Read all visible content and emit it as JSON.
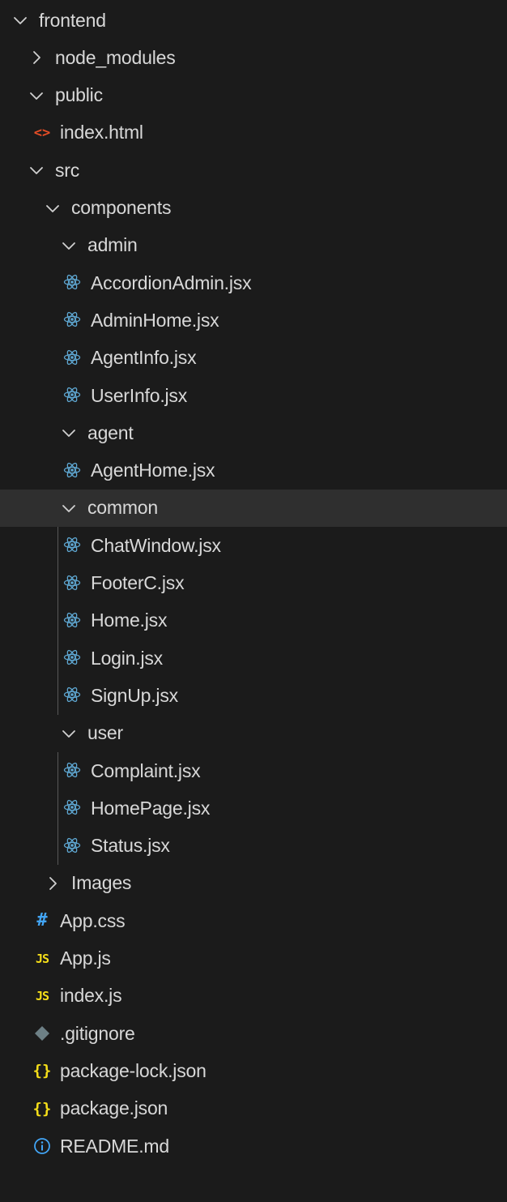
{
  "explorer": {
    "items": [
      {
        "label": "frontend",
        "kind": "folder-open",
        "depth": 0
      },
      {
        "label": "node_modules",
        "kind": "folder-closed",
        "depth": 1
      },
      {
        "label": "public",
        "kind": "folder-open",
        "depth": 1
      },
      {
        "label": "index.html",
        "kind": "html-file",
        "depth": 2
      },
      {
        "label": "src",
        "kind": "folder-open",
        "depth": 1
      },
      {
        "label": "components",
        "kind": "folder-open",
        "depth": 2
      },
      {
        "label": "admin",
        "kind": "folder-open",
        "depth": 3
      },
      {
        "label": "AccordionAdmin.jsx",
        "kind": "react-file",
        "depth": 4
      },
      {
        "label": "AdminHome.jsx",
        "kind": "react-file",
        "depth": 4
      },
      {
        "label": "AgentInfo.jsx",
        "kind": "react-file",
        "depth": 4
      },
      {
        "label": "UserInfo.jsx",
        "kind": "react-file",
        "depth": 4
      },
      {
        "label": "agent",
        "kind": "folder-open",
        "depth": 3
      },
      {
        "label": "AgentHome.jsx",
        "kind": "react-file",
        "depth": 4
      },
      {
        "label": "common",
        "kind": "folder-open",
        "depth": 3,
        "selected": true
      },
      {
        "label": "ChatWindow.jsx",
        "kind": "react-file",
        "depth": 4
      },
      {
        "label": "FooterC.jsx",
        "kind": "react-file",
        "depth": 4
      },
      {
        "label": "Home.jsx",
        "kind": "react-file",
        "depth": 4
      },
      {
        "label": "Login.jsx",
        "kind": "react-file",
        "depth": 4
      },
      {
        "label": "SignUp.jsx",
        "kind": "react-file",
        "depth": 4
      },
      {
        "label": "user",
        "kind": "folder-open",
        "depth": 3
      },
      {
        "label": "Complaint.jsx",
        "kind": "react-file",
        "depth": 4
      },
      {
        "label": "HomePage.jsx",
        "kind": "react-file",
        "depth": 4
      },
      {
        "label": "Status.jsx",
        "kind": "react-file",
        "depth": 4
      },
      {
        "label": "Images",
        "kind": "folder-closed",
        "depth": 2
      },
      {
        "label": "App.css",
        "kind": "css-file",
        "depth": 2
      },
      {
        "label": "App.js",
        "kind": "js-file",
        "depth": 2
      },
      {
        "label": "index.js",
        "kind": "js-file",
        "depth": 2
      },
      {
        "label": ".gitignore",
        "kind": "git-file",
        "depth": 1
      },
      {
        "label": "package-lock.json",
        "kind": "json-file",
        "depth": 1
      },
      {
        "label": "package.json",
        "kind": "json-file",
        "depth": 1
      },
      {
        "label": "README.md",
        "kind": "info-file",
        "depth": 1
      }
    ]
  },
  "icons": {
    "html-file": {
      "name": "html-icon",
      "glyph": "<>"
    },
    "css-file": {
      "name": "css-hash-icon",
      "glyph": "#"
    },
    "js-file": {
      "name": "js-icon",
      "glyph": "JS"
    },
    "json-file": {
      "name": "json-braces-icon",
      "glyph": "{}"
    },
    "git-file": {
      "name": "git-diamond-icon",
      "glyph": ""
    },
    "info-file": {
      "name": "info-icon",
      "glyph": ""
    },
    "react-file": {
      "name": "react-icon",
      "glyph": ""
    }
  },
  "colors": {
    "background": "#1b1b1b",
    "selected_row": "#2f2f2f",
    "text": "#d8d8d8",
    "guide_line": "#585858",
    "react_icon": "#5fa8d3",
    "html_icon": "#e44d26",
    "css_icon": "#42a5f5",
    "js_icon": "#f5de19",
    "json_icon": "#f5de19",
    "git_icon": "#6d8086",
    "info_icon": "#42a5f5"
  }
}
